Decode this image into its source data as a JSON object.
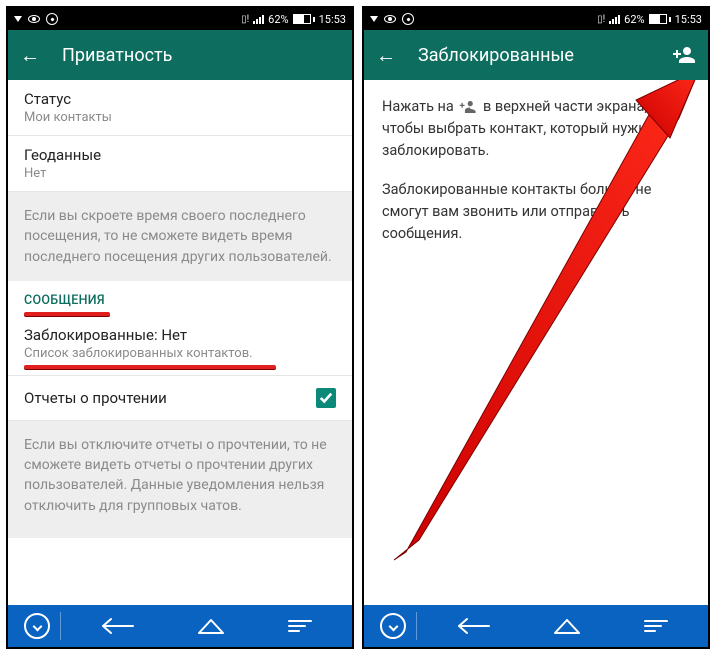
{
  "status": {
    "battery_pct": "62%",
    "time": "15:53"
  },
  "left": {
    "title": "Приватность",
    "status_label": "Статус",
    "status_value": "Мои контакты",
    "geo_label": "Геоданные",
    "geo_value": "Нет",
    "info1": "Если вы скроете время своего последнего посещения, то не сможете видеть время последнего посещения других пользователей.",
    "section_messages": "СООБЩЕНИЯ",
    "blocked_title": "Заблокированные: Нет",
    "blocked_sub": "Список заблокированных контактов.",
    "read_receipts": "Отчеты о прочтении",
    "info2": "Если вы отключите отчеты о прочтении, то не сможете видеть отчеты о прочтении других пользователей. Данные уведомления нельзя отключить для групповых чатов."
  },
  "right": {
    "title": "Заблокированные",
    "para1a": "Нажать на ",
    "para1b": " в верхней части экрана, чтобы выбрать контакт, который нужно заблокировать.",
    "para2": "Заблокированные контакты больше не смогут вам звонить или отправлять сообщения."
  }
}
